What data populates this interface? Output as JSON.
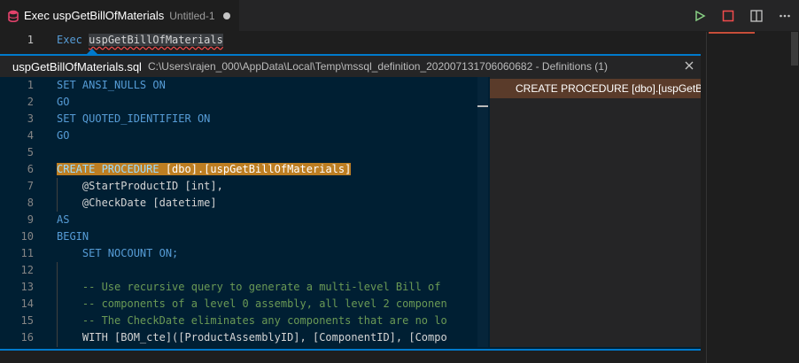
{
  "tab": {
    "title": "Exec uspGetBillOfMaterials",
    "subtitle": "Untitled-1",
    "icon": "database-icon"
  },
  "actions": {
    "run": "run-icon",
    "stop": "stop-icon",
    "split": "split-editor-icon",
    "more": "more-icon"
  },
  "editor": {
    "line1": {
      "num": "1",
      "keyword": "Exec",
      "ident": "uspGetBillOfMaterials"
    }
  },
  "peek": {
    "file": "uspGetBillOfMaterials.sql",
    "path": "C:\\Users\\rajen_000\\AppData\\Local\\Temp\\mssql_definition_202007131706060682 - Definitions (1)",
    "reference": "CREATE PROCEDURE [dbo].[uspGetBillOfMaterials]",
    "lines": [
      {
        "num": "1",
        "code": "SET ANSI_NULLS ON",
        "type": "kw"
      },
      {
        "num": "2",
        "code": "GO",
        "type": "kw"
      },
      {
        "num": "3",
        "code": "SET QUOTED_IDENTIFIER ON",
        "type": "kw"
      },
      {
        "num": "4",
        "code": "GO",
        "type": "kw"
      },
      {
        "num": "5",
        "code": "",
        "type": "plain"
      },
      {
        "num": "6",
        "code": "CREATE PROCEDURE [dbo].[uspGetBillOfMaterials]",
        "type": "hl"
      },
      {
        "num": "7",
        "code": "    @StartProductID [int],",
        "type": "plain"
      },
      {
        "num": "8",
        "code": "    @CheckDate [datetime]",
        "type": "plain"
      },
      {
        "num": "9",
        "code": "AS",
        "type": "kw"
      },
      {
        "num": "10",
        "code": "BEGIN",
        "type": "kw"
      },
      {
        "num": "11",
        "code": "    SET NOCOUNT ON;",
        "type": "kw"
      },
      {
        "num": "12",
        "code": "",
        "type": "plain"
      },
      {
        "num": "13",
        "code": "    -- Use recursive query to generate a multi-level Bill of",
        "type": "cm"
      },
      {
        "num": "14",
        "code": "    -- components of a level 0 assembly, all level 2 componen",
        "type": "cm"
      },
      {
        "num": "15",
        "code": "    -- The CheckDate eliminates any components that are no lo",
        "type": "cm"
      },
      {
        "num": "16",
        "code": "    WITH [BOM_cte]([ProductAssemblyID], [ComponentID], [Compo",
        "type": "plain"
      }
    ]
  },
  "colors": {
    "accent": "#007acc",
    "highlight": "#bd7e22",
    "keyword": "#569cd6",
    "comment": "#6a9955"
  }
}
